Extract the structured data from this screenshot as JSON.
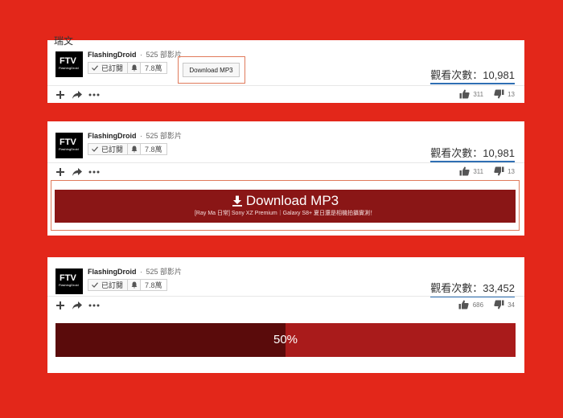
{
  "colors": {
    "background": "#e3271a",
    "panel": "#ffffff",
    "highlight_border": "#e07a5b",
    "download_button": "#8a1616",
    "views_underline": "#2f6fb3",
    "progress_dark": "#5a0b0b",
    "progress_bg": "#a91b1b"
  },
  "icons": {
    "download": "download-arrow-icon",
    "check": "checkmark-icon",
    "bell": "bell-icon",
    "add": "plus-icon",
    "share": "share-arrow-icon",
    "more": "ellipsis-icon",
    "like": "thumbs-up-icon",
    "dislike": "thumbs-down-icon"
  },
  "panel_1": {
    "top_cut_text": "瑞文",
    "channel_logo_text": "FTV",
    "channel_logo_sub": "FlashingDroid",
    "channel_name": "FlashingDroid",
    "separator": "·",
    "video_count": "525 部影片",
    "subscribe_label": "已訂閱",
    "subscriber_count": "7.8萬",
    "download_small_label": "Download MP3",
    "views_label": "觀看次數：10,981",
    "like_count": "311",
    "dislike_count": "13"
  },
  "panel_2": {
    "channel_logo_text": "FTV",
    "channel_logo_sub": "FlashingDroid",
    "channel_name": "FlashingDroid",
    "separator": "·",
    "video_count": "525 部影片",
    "subscribe_label": "已訂閱",
    "subscriber_count": "7.8萬",
    "views_label": "觀看次數：10,981",
    "like_count": "311",
    "dislike_count": "13",
    "download_big_label": "Download MP3",
    "download_big_subtitle": "[Ray Ma 日常] Sony XZ Premium｜Galaxy S8+ 夏日還是相機拍攝實測！"
  },
  "panel_3": {
    "channel_logo_text": "FTV",
    "channel_logo_sub": "FlashingDroid",
    "channel_name": "FlashingDroid",
    "separator": "·",
    "video_count": "525 部影片",
    "subscribe_label": "已訂閱",
    "subscriber_count": "7.8萬",
    "views_label": "觀看次數：33,452",
    "like_count": "686",
    "dislike_count": "34",
    "progress_percent": 50,
    "progress_label": "50%"
  }
}
